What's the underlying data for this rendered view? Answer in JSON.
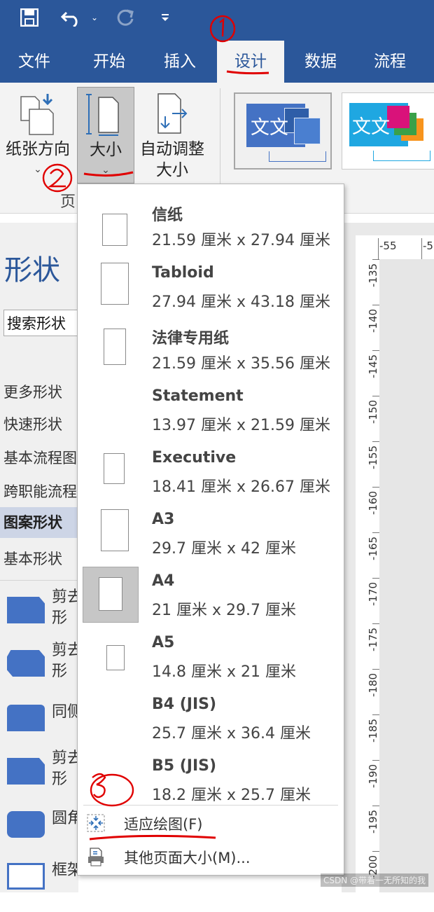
{
  "ribbon_tabs": [
    {
      "label": "文件"
    },
    {
      "label": "开始"
    },
    {
      "label": "插入"
    },
    {
      "label": "设计",
      "active": true
    },
    {
      "label": "数据"
    },
    {
      "label": "流程"
    }
  ],
  "quick_access": {
    "icons": [
      "save-icon",
      "undo-icon",
      "chevron-down-icon",
      "redo-icon",
      "customize-icon"
    ]
  },
  "ribbon": {
    "orientation": {
      "label": "纸张方向"
    },
    "size": {
      "label": "大小"
    },
    "autosize": {
      "label_line1": "自动调整",
      "label_line2": "大小"
    },
    "group_label_partial": "页",
    "themes": [
      {
        "text": "文文"
      },
      {
        "text": "文文"
      }
    ]
  },
  "shapes_panel": {
    "title": "形状",
    "search_value": "搜索形状",
    "stencils": [
      {
        "label": "更多形状"
      },
      {
        "label": "快速形状"
      },
      {
        "label": "基本流程图"
      },
      {
        "label": "跨职能流程"
      },
      {
        "label": "图案形状",
        "active": true
      },
      {
        "label": "基本形状"
      }
    ],
    "shapes": [
      {
        "label_line1": "剪去",
        "label_line2": "形"
      },
      {
        "label_line1": "剪去",
        "label_line2": "形"
      },
      {
        "label_line1": "同侧",
        "label_line2": ""
      },
      {
        "label_line1": "剪去",
        "label_line2": "形"
      },
      {
        "label_line1": "圆角",
        "label_line2": ""
      },
      {
        "label_line1": "框架",
        "label_line2": ""
      }
    ],
    "partial_shape_label": "框架用"
  },
  "rulers": {
    "horizontal_ticks": [
      "-55",
      "-5"
    ],
    "vertical_ticks": [
      "-135",
      "-140",
      "-145",
      "-150",
      "-155",
      "-160",
      "-165",
      "-170",
      "-175",
      "-180",
      "-185",
      "-190",
      "-195",
      "-200"
    ]
  },
  "size_menu": {
    "options": [
      {
        "name": "信纸",
        "dims": "21.59 厘米 x 27.94 厘米"
      },
      {
        "name": "Tabloid",
        "dims": "27.94 厘米 x 43.18 厘米"
      },
      {
        "name": "法律专用纸",
        "dims": "21.59 厘米 x 35.56 厘米"
      },
      {
        "name": "Statement",
        "dims": "13.97 厘米 x 21.59 厘米"
      },
      {
        "name": "Executive",
        "dims": "18.41 厘米 x 26.67 厘米"
      },
      {
        "name": "A3",
        "dims": "29.7 厘米 x 42 厘米"
      },
      {
        "name": "A4",
        "dims": "21 厘米 x 29.7 厘米",
        "selected": true
      },
      {
        "name": "A5",
        "dims": "14.8 厘米 x 21 厘米"
      },
      {
        "name": "B4 (JIS)",
        "dims": "25.7 厘米 x 36.4 厘米"
      },
      {
        "name": "B5 (JIS)",
        "dims": "18.2 厘米 x 25.7 厘米"
      }
    ],
    "commands": [
      {
        "label": "适应绘图(F)",
        "icon": "fit-to-drawing-icon"
      },
      {
        "label": "其他页面大小(M)...",
        "icon": "page-setup-icon"
      }
    ]
  },
  "watermark": "CSDN @带着一无所知的我",
  "colors": {
    "ribbon_blue": "#2b579a",
    "annotation_red": "#e00000",
    "shape_blue": "#4472c4"
  }
}
